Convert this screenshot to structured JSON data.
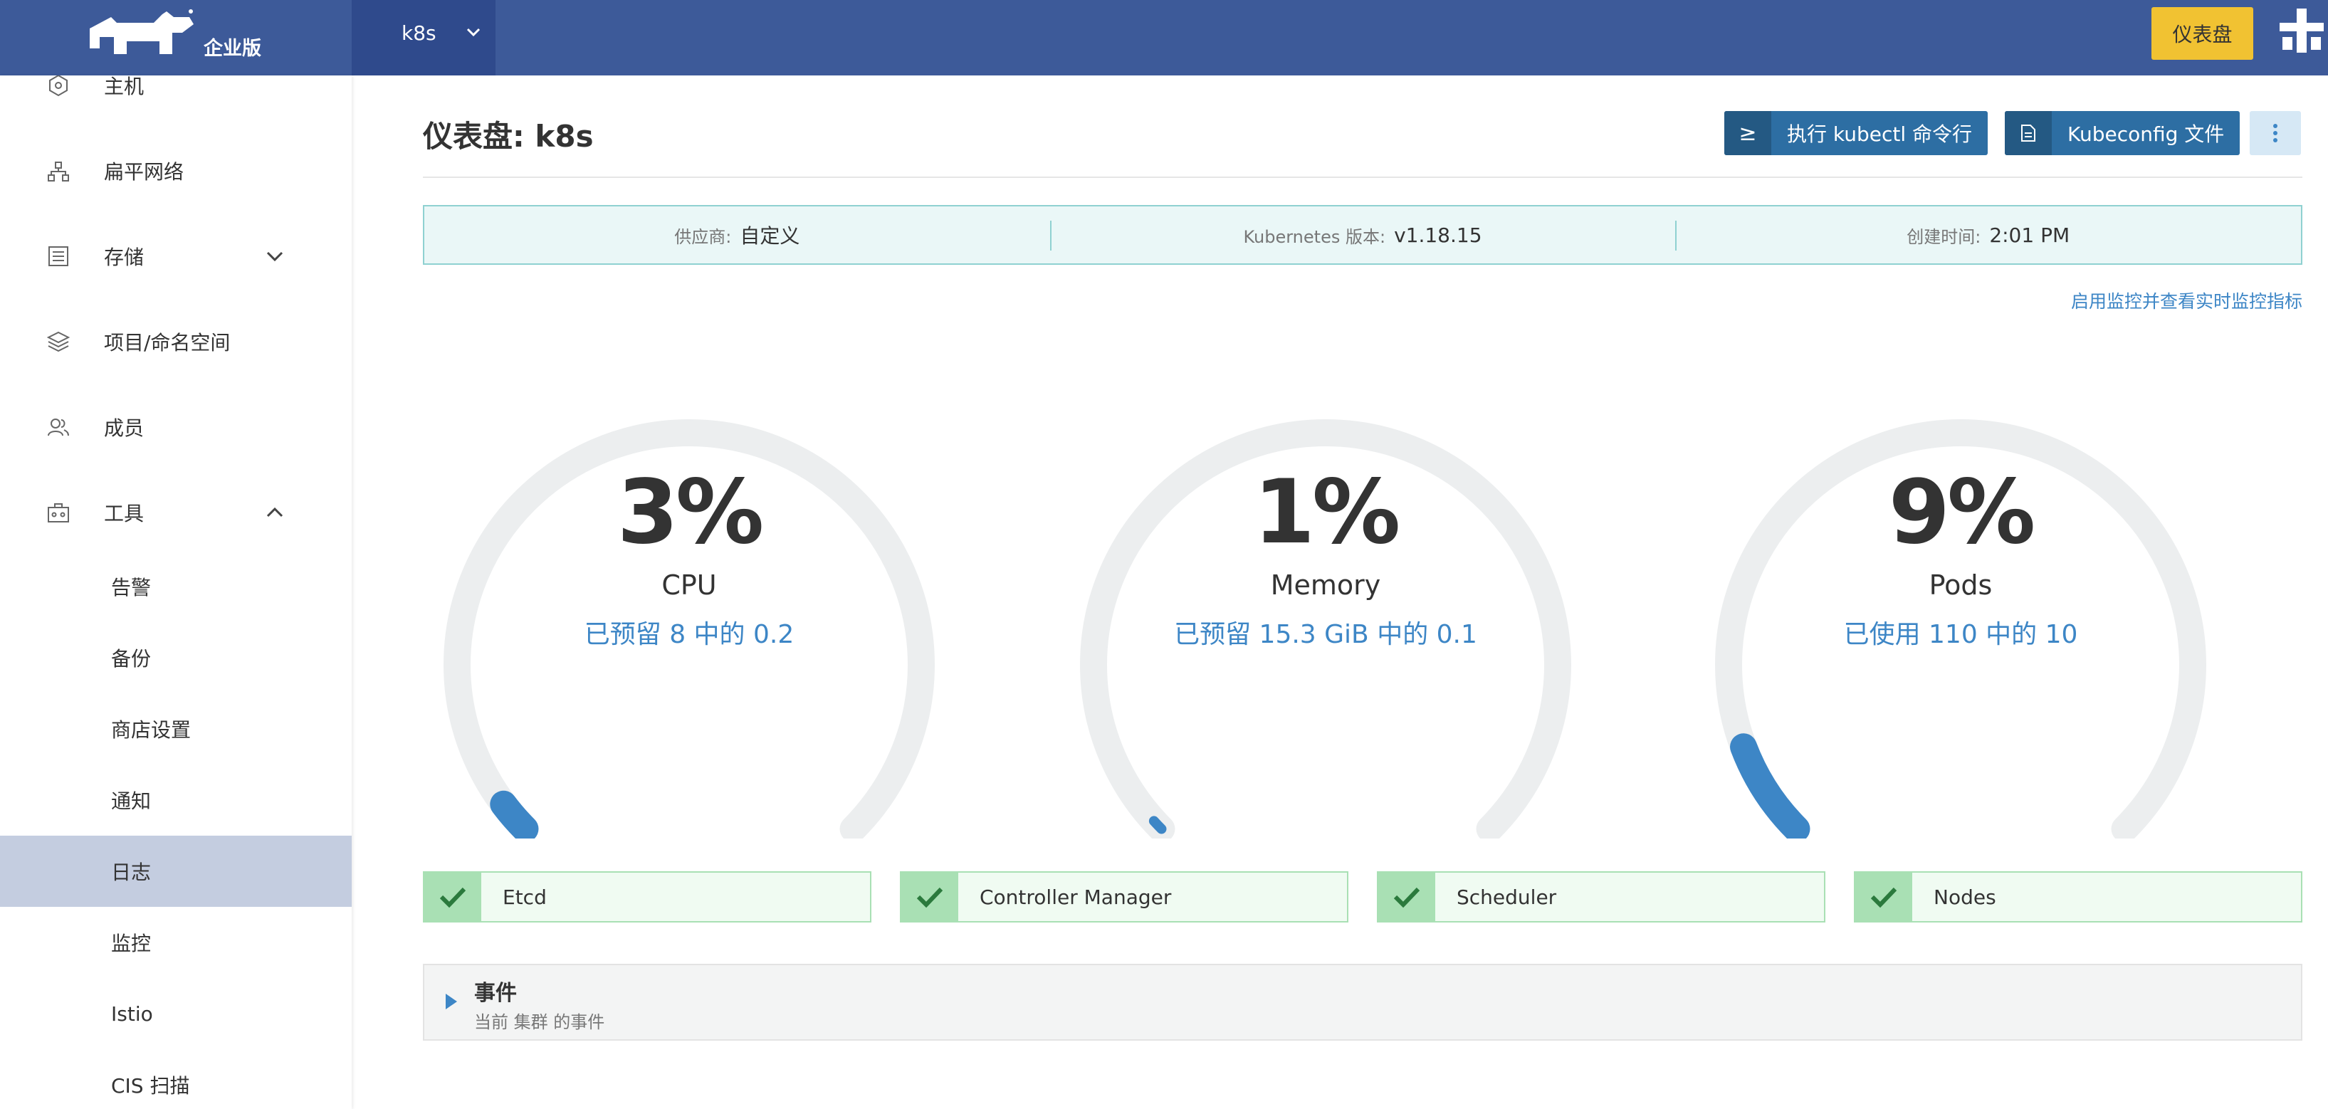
{
  "header": {
    "edition": "企业版",
    "cluster_name": "k8s",
    "dashboard_button": "仪表盘"
  },
  "sidebar": {
    "items": [
      {
        "label": "主机",
        "icon": "host-icon"
      },
      {
        "label": "扁平网络",
        "icon": "network-icon"
      },
      {
        "label": "存储",
        "icon": "storage-icon",
        "expandable": true,
        "expanded": false
      },
      {
        "label": "项目/命名空间",
        "icon": "layers-icon"
      },
      {
        "label": "成员",
        "icon": "members-icon"
      },
      {
        "label": "工具",
        "icon": "toolbox-icon",
        "expandable": true,
        "expanded": true
      }
    ],
    "tools_sub": [
      {
        "label": "告警"
      },
      {
        "label": "备份"
      },
      {
        "label": "商店设置"
      },
      {
        "label": "通知"
      },
      {
        "label": "日志",
        "active": true
      },
      {
        "label": "监控"
      },
      {
        "label": "Istio"
      },
      {
        "label": "CIS 扫描"
      }
    ]
  },
  "main": {
    "title": "仪表盘: k8s",
    "kubectl_button": "执行 kubectl 命令行",
    "kubeconfig_button": "Kubeconfig 文件",
    "info": {
      "provider_label": "供应商:",
      "provider_value": "自定义",
      "version_label": "Kubernetes 版本:",
      "version_value": "v1.18.15",
      "created_label": "创建时间:",
      "created_value": "2:01 PM"
    },
    "monitor_link": "启用监控并查看实时监控指标",
    "gauges": [
      {
        "percent_text": "3%",
        "percent": 3,
        "name": "CPU",
        "detail": "已预留 8 中的 0.2"
      },
      {
        "percent_text": "1%",
        "percent": 1,
        "name": "Memory",
        "detail": "已预留 15.3 GiB 中的 0.1"
      },
      {
        "percent_text": "9%",
        "percent": 9,
        "name": "Pods",
        "detail": "已使用 110 中的 10"
      }
    ],
    "components": [
      {
        "label": "Etcd"
      },
      {
        "label": "Controller Manager"
      },
      {
        "label": "Scheduler"
      },
      {
        "label": "Nodes"
      }
    ],
    "events": {
      "title": "事件",
      "subtitle": "当前 集群 的事件"
    }
  },
  "colors": {
    "header": "#3d5a99",
    "accent_blue": "#3d86c6",
    "gauge_track": "#eceeef",
    "ok_green": "#a9e0b4",
    "dash_button": "#f1c232"
  }
}
